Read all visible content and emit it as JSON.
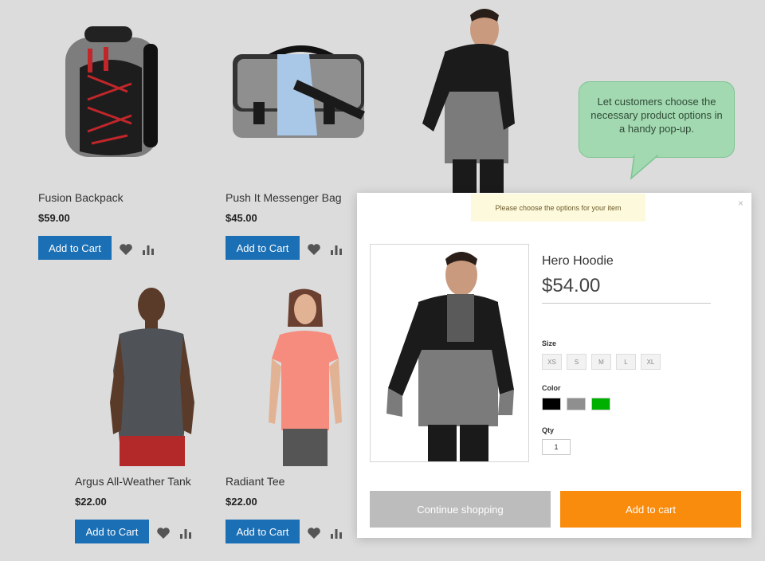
{
  "products": [
    {
      "name": "Fusion Backpack",
      "price": "$59.00",
      "add_label": "Add to Cart"
    },
    {
      "name": "Push It Messenger Bag",
      "price": "$45.00",
      "add_label": "Add to Cart"
    },
    {
      "name": "Argus All-Weather Tank",
      "price": "$22.00",
      "add_label": "Add to Cart"
    },
    {
      "name": "Radiant Tee",
      "price": "$22.00",
      "add_label": "Add to Cart"
    }
  ],
  "callout": {
    "text": "Let customers choose the necessary product options in a handy pop-up."
  },
  "modal": {
    "notice": "Please choose the options for your item",
    "close_glyph": "×",
    "product_name": "Hero Hoodie",
    "price": "$54.00",
    "size_label": "Size",
    "sizes": [
      "XS",
      "S",
      "M",
      "L",
      "XL"
    ],
    "color_label": "Color",
    "colors": [
      "#000000",
      "#8f8f8f",
      "#00b000"
    ],
    "qty_label": "Qty",
    "qty_value": "1",
    "continue_label": "Continue shopping",
    "add_label": "Add to cart"
  },
  "icons": {
    "wishlist": "heart-icon",
    "compare": "compare-icon"
  }
}
